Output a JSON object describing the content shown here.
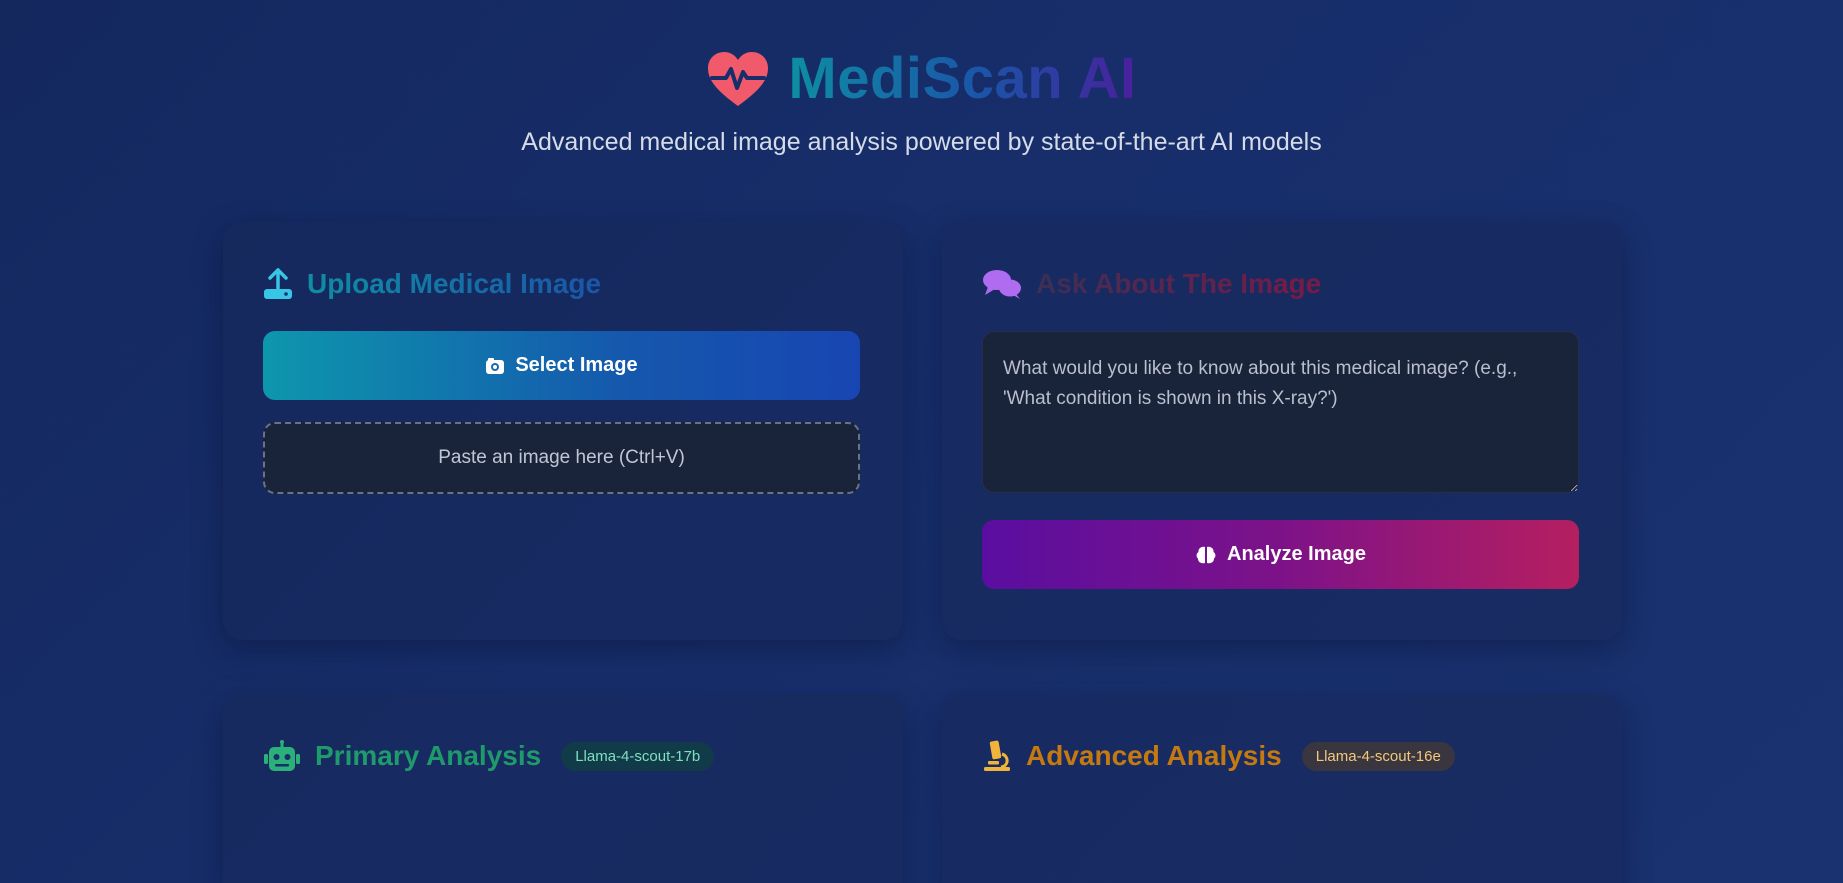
{
  "header": {
    "logo_icon": "heart-pulse-icon",
    "title": "MediScan AI",
    "subtitle": "Advanced medical image analysis powered by state-of-the-art AI models"
  },
  "upload": {
    "icon": "upload-icon",
    "title": "Upload Medical Image",
    "select_icon": "camera-icon",
    "select_label": "Select Image",
    "paste_label": "Paste an image here (Ctrl+V)"
  },
  "ask": {
    "icon": "chat-bubbles-icon",
    "title": "Ask About The Image",
    "question_placeholder": "What would you like to know about this medical image? (e.g., 'What condition is shown in this X-ray?')",
    "question_value": "",
    "analyze_icon": "brain-icon",
    "analyze_label": "Analyze Image"
  },
  "primary": {
    "icon": "robot-icon",
    "title": "Primary Analysis",
    "model": "Llama-4-scout-17b"
  },
  "advanced": {
    "icon": "microscope-icon",
    "title": "Advanced Analysis",
    "model": "Llama-4-scout-16e"
  },
  "colors": {
    "background": "#172e6b",
    "heart": "#f05a6a",
    "upload_accent": "#38c6e6",
    "ask_accent": "#b06cf0",
    "primary_accent": "#2bb07a",
    "advanced_accent": "#f0b43a"
  }
}
